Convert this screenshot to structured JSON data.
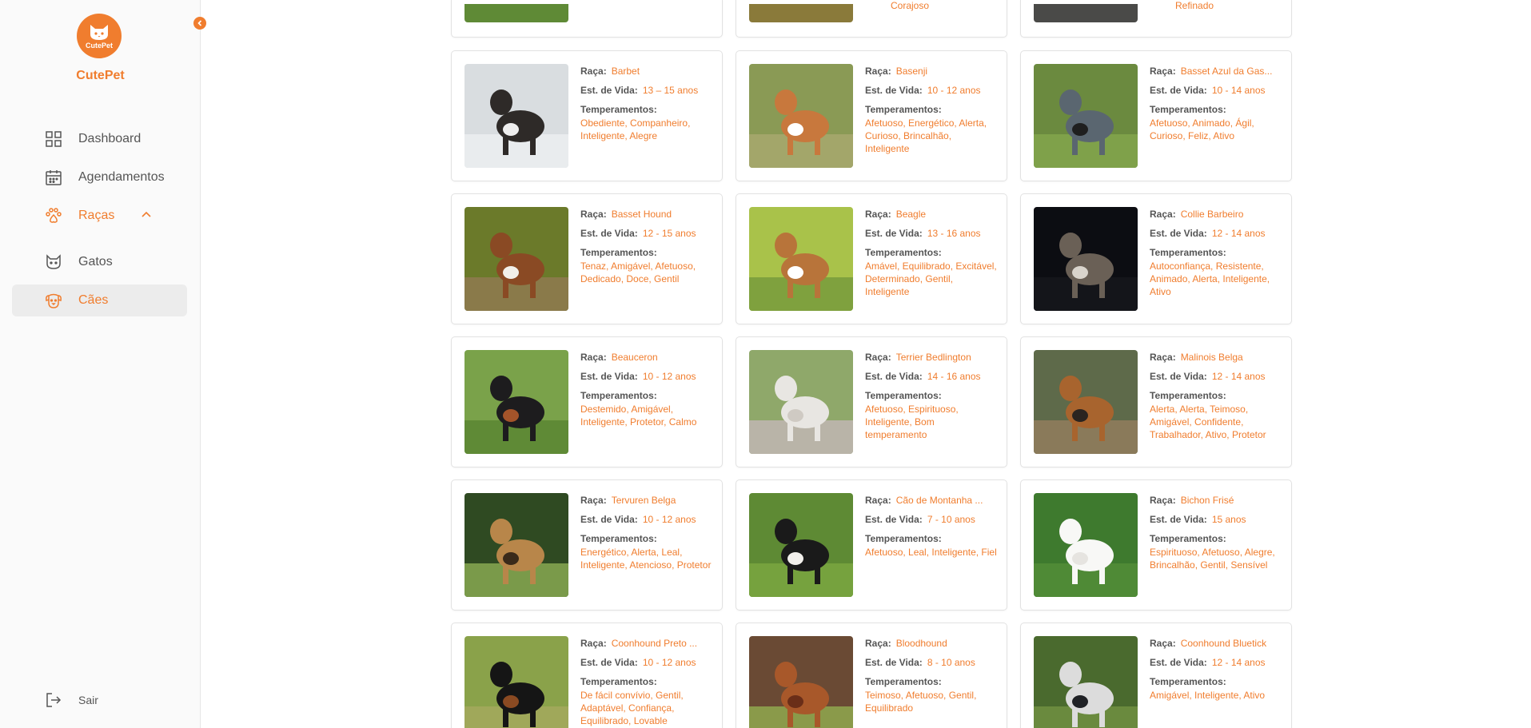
{
  "app": {
    "logo_text": "CutePet",
    "brand": "CutePet"
  },
  "sidebar": {
    "items": [
      {
        "label": "Dashboard",
        "icon": "dashboard-icon"
      },
      {
        "label": "Agendamentos",
        "icon": "calendar-icon"
      },
      {
        "label": "Raças",
        "icon": "paw-icon"
      },
      {
        "label": "Gatos",
        "icon": "cat-icon"
      },
      {
        "label": "Cães",
        "icon": "dog-icon"
      }
    ],
    "logout": "Sair"
  },
  "labels": {
    "breed": "Raça:",
    "life": "Est. de Vida:",
    "temperaments": "Temperamentos:"
  },
  "top_partial": [
    "Corajoso",
    "Refinado"
  ],
  "breeds": [
    {
      "breed": "Barbet",
      "life": "13 – 15 anos",
      "temper": "Obediente, Companheiro, Inteligente, Alegre",
      "photo": {
        "bg": "#d9dde0",
        "ground": "#e9ecee",
        "dog": "#2e2a28",
        "accent": "#eeeeee"
      }
    },
    {
      "breed": "Basenji",
      "life": "10 - 12 anos",
      "temper": "Afetuoso, Energético, Alerta, Curioso, Brincalhão, Inteligente",
      "photo": {
        "bg": "#8a9a55",
        "ground": "#a3a66a",
        "dog": "#c8783d",
        "accent": "#ffffff"
      }
    },
    {
      "breed": "Basset Azul da Gas...",
      "life": "10 - 14 anos",
      "temper": "Afetuoso, Animado, Ágil, Curioso, Feliz, Ativo",
      "photo": {
        "bg": "#6b8a3f",
        "ground": "#7fa14a",
        "dog": "#5a6670",
        "accent": "#1f1f1f"
      }
    },
    {
      "breed": "Basset Hound",
      "life": "12 - 15 anos",
      "temper": "Tenaz, Amigável, Afetuoso, Dedicado, Doce, Gentil",
      "photo": {
        "bg": "#6b7a2a",
        "ground": "#8a7a4a",
        "dog": "#8a4a24",
        "accent": "#f2f0ea"
      }
    },
    {
      "breed": "Beagle",
      "life": "13 - 16 anos",
      "temper": "Amável, Equilibrado, Excitável, Determinado, Gentil, Inteligente",
      "photo": {
        "bg": "#a9c24a",
        "ground": "#7fa13e",
        "dog": "#b8743a",
        "accent": "#ffffff"
      }
    },
    {
      "breed": "Collie Barbeiro",
      "life": "12 - 14 anos",
      "temper": "Autoconfiança, Resistente, Animado, Alerta, Inteligente, Ativo",
      "photo": {
        "bg": "#0c0d12",
        "ground": "#14151a",
        "dog": "#6a6056",
        "accent": "#d9d4cc"
      }
    },
    {
      "breed": "Beauceron",
      "life": "10 - 12 anos",
      "temper": "Destemido, Amigável, Inteligente, Protetor, Calmo",
      "photo": {
        "bg": "#7aa24a",
        "ground": "#5f8a36",
        "dog": "#1d1c1e",
        "accent": "#a4542a"
      }
    },
    {
      "breed": "Terrier Bedlington",
      "life": "14 - 16 anos",
      "temper": "Afetuoso, Espirituoso, Inteligente, Bom temperamento",
      "photo": {
        "bg": "#8fa86a",
        "ground": "#b9b4a8",
        "dog": "#e8e6e2",
        "accent": "#cfcac3"
      }
    },
    {
      "breed": "Malinois Belga",
      "life": "12 - 14 anos",
      "temper": "Alerta, Alerta, Teimoso, Amigável, Confidente, Trabalhador, Ativo, Protetor",
      "photo": {
        "bg": "#5e6a4a",
        "ground": "#8a7a5a",
        "dog": "#a8642e",
        "accent": "#2a2420"
      }
    },
    {
      "breed": "Tervuren Belga",
      "life": "10 - 12 anos",
      "temper": "Energético, Alerta, Leal, Inteligente, Atencioso, Protetor",
      "photo": {
        "bg": "#2f4a22",
        "ground": "#7a9a4a",
        "dog": "#b8864a",
        "accent": "#3a2a1a"
      }
    },
    {
      "breed": "Cão de Montanha ...",
      "life": "7 - 10 anos",
      "temper": "Afetuoso, Leal, Inteligente, Fiel",
      "photo": {
        "bg": "#5e8a34",
        "ground": "#76a23e",
        "dog": "#1a1a1a",
        "accent": "#f2f0ec"
      }
    },
    {
      "breed": "Bichon Frisé",
      "life": "15 anos",
      "temper": "Espirituoso, Afetuoso, Alegre, Brincalhão, Gentil, Sensível",
      "photo": {
        "bg": "#3e7a2e",
        "ground": "#4f8a36",
        "dog": "#f8f8f6",
        "accent": "#e6e4e0"
      }
    },
    {
      "breed": "Coonhound Preto ...",
      "life": "10 - 12 anos",
      "temper": "De fácil convívio, Gentil, Adaptável, Confiança, Equilibrado, Lovable",
      "photo": {
        "bg": "#8aa24a",
        "ground": "#a0a85a",
        "dog": "#151515",
        "accent": "#8a4a22"
      }
    },
    {
      "breed": "Bloodhound",
      "life": "8 - 10 anos",
      "temper": "Teimoso, Afetuoso, Gentil, Equilibrado",
      "photo": {
        "bg": "#6a4a34",
        "ground": "#8a9a4a",
        "dog": "#a8582a",
        "accent": "#6a2e18"
      }
    },
    {
      "breed": "Coonhound Bluetick",
      "life": "12 - 14 anos",
      "temper": "Amigável, Inteligente, Ativo",
      "photo": {
        "bg": "#4a6a2e",
        "ground": "#6a8a3e",
        "dog": "#dcdcdc",
        "accent": "#202226"
      }
    }
  ]
}
